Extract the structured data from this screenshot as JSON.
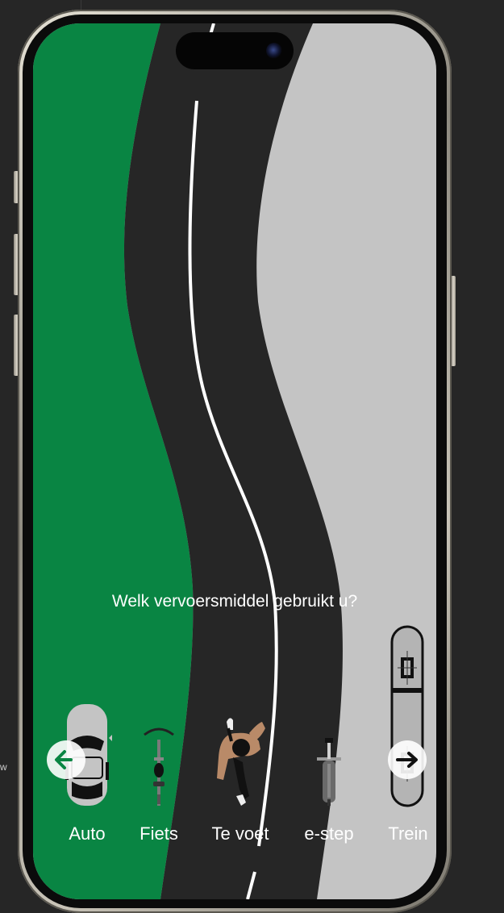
{
  "app": {
    "question": "Welk vervoersmiddel gebruikt u?"
  },
  "colors": {
    "grass": "#098543",
    "road": "#262626",
    "pavement": "#c4c4c4",
    "lane_line": "#ffffff",
    "text": "#ffffff"
  },
  "editor": {
    "edge_text": "w"
  },
  "transport_options": [
    {
      "label": "Auto",
      "icon": "car-icon"
    },
    {
      "label": "Fiets",
      "icon": "bicycle-icon"
    },
    {
      "label": "Te voet",
      "icon": "pedestrian-icon"
    },
    {
      "label": "e-step",
      "icon": "e-scooter-icon"
    },
    {
      "label": "Trein",
      "icon": "train-icon"
    }
  ],
  "navigation": {
    "previous_icon": "arrow-left-icon",
    "next_icon": "arrow-right-icon"
  }
}
